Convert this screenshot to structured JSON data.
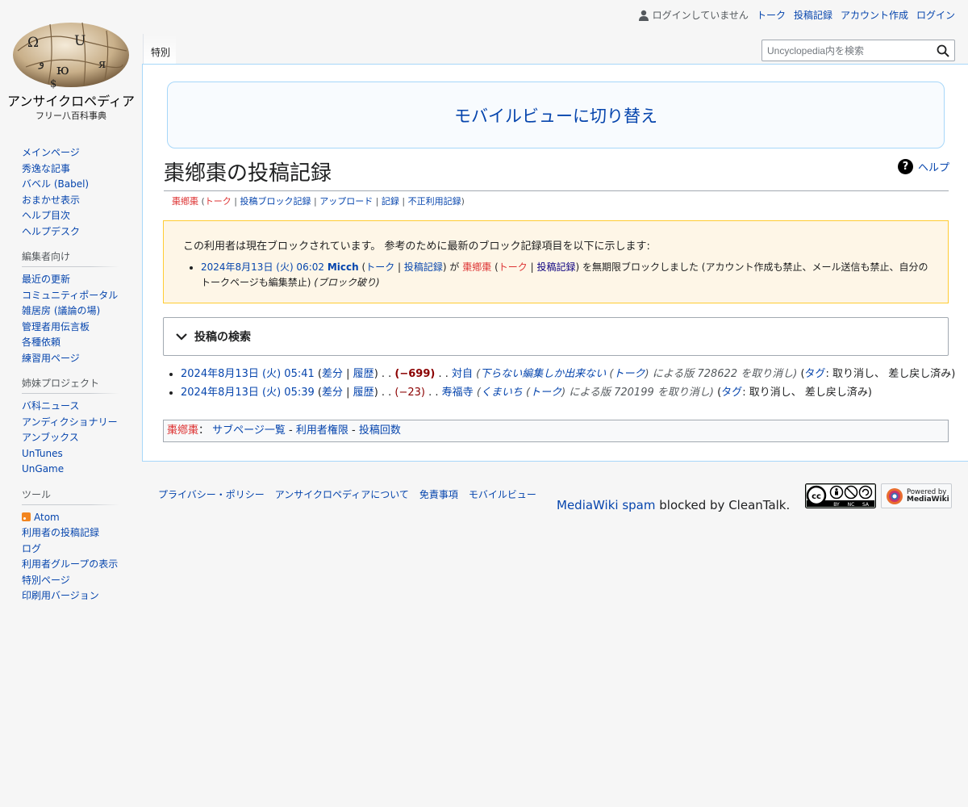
{
  "logo": {
    "site_name": "アンサイクロペディア",
    "tagline": "フリー八百科事典",
    "glyphs": [
      "Ω",
      "U",
      "ю",
      "$",
      "و",
      "я"
    ]
  },
  "personal_tools": {
    "anon_label": "ログインしていません",
    "talk": "トーク",
    "contributions": "投稿記録",
    "create_account": "アカウント作成",
    "login": "ログイン"
  },
  "tabs": {
    "special": "特別"
  },
  "search": {
    "placeholder": "Uncyclopedia内を検索"
  },
  "sidebar": {
    "main": [
      "メインページ",
      "秀逸な記事",
      "バベル (Babel)",
      "おまかせ表示",
      "ヘルプ目次",
      "ヘルプデスク"
    ],
    "editors": {
      "heading": "編集者向け",
      "items": [
        "最近の更新",
        "コミュニティポータル",
        "雑居房 (議論の場)",
        "管理者用伝言板",
        "各種依頼",
        "練習用ページ"
      ]
    },
    "sister": {
      "heading": "姉妹プロジェクト",
      "items": [
        "バ科ニュース",
        "アンディクショナリー",
        "アンブックス",
        "UnTunes",
        "UnGame"
      ]
    },
    "tools": {
      "heading": "ツール",
      "items": [
        "Atom",
        "利用者の投稿記録",
        "ログ",
        "利用者グループの表示",
        "特別ページ",
        "印刷用バージョン"
      ]
    }
  },
  "mobile_switch": "モバイルビューに切り替え",
  "page": {
    "title": "棗鄕棗の投稿記録",
    "help": "ヘルプ",
    "subtitle": {
      "user": "棗鄕棗",
      "links": [
        "トーク",
        "投稿ブロック記録",
        "アップロード",
        "記録",
        "不正利用記録"
      ]
    }
  },
  "block_notice": {
    "message": "この利用者は現在ブロックされています。 参考のために最新のブロック記録項目を以下に示します:",
    "timestamp": "2024年8月13日 (火) 06:02",
    "admin": "Micch",
    "talk": "トーク",
    "contribs": "投稿記録",
    "ga": "が",
    "target": "棗鄕棗",
    "action": "を無期限ブロックしました (アカウント作成も禁止、メール送信も禁止、自分のトークページも編集禁止)",
    "reason": "(ブロック破り)"
  },
  "search_form": {
    "legend": "投稿の検索"
  },
  "contributions": [
    {
      "timestamp": "2024年8月13日 (火) 05:41",
      "diff": "差分",
      "hist": "履歴",
      "size": "(−699)",
      "title": "対自",
      "comment_user": "下らない編集しか出来ない",
      "comment_talk": "トーク",
      "comment_rest": "による版 728622 を取り消し",
      "tag_label": "タグ",
      "tags": ": 取り消し、 差し戻し済み"
    },
    {
      "timestamp": "2024年8月13日 (火) 05:39",
      "diff": "差分",
      "hist": "履歴",
      "size": "(−23)",
      "title": "寿福寺",
      "comment_user": "くまいち",
      "comment_talk": "トーク",
      "comment_rest": "による版 720199 を取り消し",
      "tag_label": "タグ",
      "tags": ": 取り消し、 差し戻し済み"
    }
  ],
  "user_footer": {
    "user": "棗鄕棗",
    "colon": "：",
    "subpages": "サブページ一覧",
    "rights": "利用者権限",
    "editcount": "投稿回数"
  },
  "footer": {
    "links": [
      "プライバシー・ポリシー",
      "アンサイクロペディアについて",
      "免責事項",
      "モバイルビュー"
    ],
    "cleantalk_link": "MediaWiki spam",
    "cleantalk_rest": " blocked by CleanTalk.",
    "cc_badge": {
      "cc": "cc",
      "tags": [
        "BY",
        "NC",
        "SA"
      ]
    },
    "powered": {
      "line1": "Powered by",
      "line2": "MediaWiki"
    }
  }
}
